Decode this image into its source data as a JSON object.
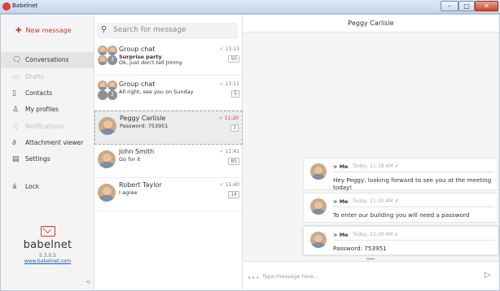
{
  "window": {
    "title": "Babelnet",
    "controls": [
      "–",
      "□",
      "✕"
    ]
  },
  "sidebar": {
    "new_message": "New message",
    "items": [
      {
        "label": "Conversations",
        "icon": "conversations-icon",
        "active": true,
        "disabled": false
      },
      {
        "label": "Drafts",
        "icon": "drafts-icon",
        "active": false,
        "disabled": true
      },
      {
        "label": "Contacts",
        "icon": "contacts-icon",
        "active": false,
        "disabled": false
      },
      {
        "label": "My profiles",
        "icon": "profile-icon",
        "active": false,
        "disabled": false
      },
      {
        "label": "Notifications",
        "icon": "bell-icon",
        "active": false,
        "disabled": true
      },
      {
        "label": "Attachment viewer",
        "icon": "paperclip-icon",
        "active": false,
        "disabled": false
      },
      {
        "label": "Settings",
        "icon": "settings-icon",
        "active": false,
        "disabled": false
      },
      {
        "label": "Lock",
        "icon": "lock-icon",
        "active": false,
        "disabled": false
      }
    ],
    "brand": {
      "name": "babelnet",
      "version": "5.3.0.5",
      "link": "www.babelnet.com"
    },
    "collapse": "<"
  },
  "search": {
    "placeholder": "Search for message"
  },
  "conversations": [
    {
      "name": "Group chat",
      "sub": "Surprise party",
      "sub2": "Ok, just don't tell Jimmy",
      "time": "✓ 13:13",
      "badge": "50",
      "group": true,
      "group_count": "3",
      "selected": false
    },
    {
      "name": "Group chat",
      "sub": "All right, see you on Sunday",
      "sub2": "",
      "time": "✓ 13:11",
      "badge": "5",
      "group": true,
      "group_count": "2",
      "selected": false
    },
    {
      "name": "Peggy Carlisle",
      "sub": "Password: 753951",
      "sub2": "",
      "time": "✓ 11:20",
      "badge": "3",
      "group": false,
      "selected": true
    },
    {
      "name": "John Smith",
      "sub": "Go for it",
      "sub2": "",
      "time": "✓ 11:41",
      "badge": "85",
      "group": false,
      "selected": false
    },
    {
      "name": "Robert Taylor",
      "sub": "I agree",
      "sub2": "",
      "time": "✓ 11:40",
      "badge": "14",
      "group": false,
      "selected": false
    }
  ],
  "chat": {
    "title": "Peggy Carlisle",
    "messages": [
      {
        "from": "> Me",
        "time": "Today, 11:18 AM",
        "text": "Hey Peggy, looking forward to see you at the meeting today!"
      },
      {
        "from": "> Me",
        "time": "Today, 11:20 AM",
        "text": "To enter our building you will need a password"
      },
      {
        "from": "> Me",
        "time": "Today, 11:20 AM",
        "text": "Password: 753951"
      }
    ],
    "composer": {
      "dots": "•••",
      "placeholder": "Type message here...",
      "send": "▷"
    }
  },
  "colors": {
    "accent": "#d9322b",
    "link": "#1a5fc4"
  }
}
